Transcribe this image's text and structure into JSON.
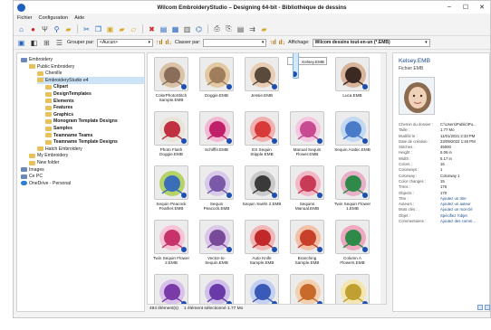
{
  "window": {
    "title": "Wilcom EmbroideryStudio – Designing 64-bit - Bibliothèque de dessins",
    "controls": [
      "–",
      "☐",
      "✕"
    ]
  },
  "menu": [
    "Fichier",
    "Configuration",
    "Aide"
  ],
  "toolbar2": {
    "group_label": "Grouper par:",
    "group_value": "<Aucun>",
    "sort_label": "Classer par:",
    "sort_value": "",
    "display_label": "Affichage:",
    "display_value": "Wilcom dessins tout-en-un (*.EMB)"
  },
  "tree": [
    {
      "label": "Embroidery",
      "icon": "drive",
      "level": 0
    },
    {
      "label": "Public Embroidery",
      "icon": "folder",
      "level": 1
    },
    {
      "label": "Chenille",
      "icon": "folder",
      "level": 2
    },
    {
      "label": "EmbroideryStudio e4",
      "icon": "folder",
      "level": 2,
      "selected": true
    },
    {
      "label": "Clipart",
      "icon": "folder",
      "level": 3
    },
    {
      "label": "DesignTemplates",
      "icon": "folder",
      "level": 3
    },
    {
      "label": "Elements",
      "icon": "folder",
      "level": 3
    },
    {
      "label": "Features",
      "icon": "folder",
      "level": 3
    },
    {
      "label": "Graphics",
      "icon": "folder",
      "level": 3
    },
    {
      "label": "Monogram Template Designs",
      "icon": "folder",
      "level": 3
    },
    {
      "label": "Samples",
      "icon": "folder",
      "level": 3
    },
    {
      "label": "Teamname Teams",
      "icon": "folder",
      "level": 3
    },
    {
      "label": "Teamname Template Designs",
      "icon": "folder",
      "level": 3
    },
    {
      "label": "Hatch Embroidery",
      "icon": "folder",
      "level": 2
    },
    {
      "label": "My Embroidery",
      "icon": "folder",
      "level": 1
    },
    {
      "label": "New folder",
      "icon": "folder",
      "level": 1
    },
    {
      "label": "Images",
      "icon": "drive",
      "level": 0
    },
    {
      "label": "Ce PC",
      "icon": "drive",
      "level": 0
    },
    {
      "label": "OneDrive - Personal",
      "icon": "cloud",
      "level": 0
    }
  ],
  "thumbnails": [
    {
      "caption": "ColorPhotoStitch Sample.EMB",
      "color": "#8a6e5a",
      "accent": "#d9c2a8"
    },
    {
      "caption": "Doggie.EMB",
      "color": "#a07d5c",
      "accent": "#e2c9a3"
    },
    {
      "caption": "Jessie.EMB",
      "color": "#5a4a3c",
      "accent": "#e8cdb4"
    },
    {
      "caption": "Kelsey.EMB",
      "color": "#9a7a5c",
      "accent": "#f0d6bf",
      "selected": true
    },
    {
      "caption": "Luca.EMB",
      "color": "#3a2a22",
      "accent": "#d8b49a"
    },
    {
      "caption": "Photo Flash Doggie.EMB",
      "color": "#c03040",
      "accent": "#e9e3d8"
    },
    {
      "caption": "SchiffliI.EMB",
      "color": "#c0206a",
      "accent": "#f3b8d2"
    },
    {
      "caption": "ES Sequin Stipple.EMB",
      "color": "#d83a3a",
      "accent": "#f2b0b0"
    },
    {
      "caption": "Manual Sequin Flower.EMB",
      "color": "#c84a90",
      "accent": "#f5c8e0"
    },
    {
      "caption": "Sequin Arabic.EMB",
      "color": "#4a7bc8",
      "accent": "#c3d8f2"
    },
    {
      "caption": "Sequin Peacock Feather.EMB",
      "color": "#3a6fb8",
      "accent": "#b6d36a"
    },
    {
      "caption": "Sequin Peacock.EMB",
      "color": "#7a5aa8",
      "accent": "#d6c9ea"
    },
    {
      "caption": "Sequin Swirls 2.EMB",
      "color": "#3a3a3a",
      "accent": "#c9c9c9"
    },
    {
      "caption": "Sequins Manual.EMB",
      "color": "#c83a58",
      "accent": "#f3b8c6"
    },
    {
      "caption": "Twin Sequin Flower 1.EMB",
      "color": "#2f8a4a",
      "accent": "#e8b0c8"
    },
    {
      "caption": "Twin Sequin Flower 2.EMB",
      "color": "#c8326a",
      "accent": "#f6c4d6"
    },
    {
      "caption": "Vector-to-Sequin.EMB",
      "color": "#7a4a9a",
      "accent": "#d9c8e8"
    },
    {
      "caption": "Auto Knife Sample.EMB",
      "color": "#c0282a",
      "accent": "#f1b7b7"
    },
    {
      "caption": "Branching Sample.EMB",
      "color": "#c8402a",
      "accent": "#f3c0a8"
    },
    {
      "caption": "Column A Flowers.EMB",
      "color": "#2f8a4a",
      "accent": "#f0a8c0"
    },
    {
      "caption": "",
      "color": "#7a3aa8",
      "accent": "#d9c2ea"
    },
    {
      "caption": "",
      "color": "#6a3aa8",
      "accent": "#cfc0ea"
    },
    {
      "caption": "",
      "color": "#3a5ab8",
      "accent": "#c3d0f2"
    },
    {
      "caption": "",
      "color": "#c86a2a",
      "accent": "#f3d0b0"
    },
    {
      "caption": "",
      "color": "#c0a030",
      "accent": "#f3e6b0"
    }
  ],
  "properties": {
    "title": "Kelsey.EMB",
    "subtitle": "Fichier EMB",
    "rows": [
      {
        "k": "Chemin du dossier :",
        "v": "C:\\Users\\Public\\Pu..."
      },
      {
        "k": "Taille :",
        "v": "1.77 Mo"
      },
      {
        "k": "Modifié le :",
        "v": "11/01/2021 2:33 PM"
      },
      {
        "k": "Date de création :",
        "v": "23/09/2022 1:46 PM"
      },
      {
        "k": "Stitches :",
        "v": "45000"
      },
      {
        "k": "Height :",
        "v": "5.06 in"
      },
      {
        "k": "Width :",
        "v": "5.17 in"
      },
      {
        "k": "Colors :",
        "v": "16"
      },
      {
        "k": "Colorways :",
        "v": "1"
      },
      {
        "k": "Colorway :",
        "v": "Colorway 1"
      },
      {
        "k": "Color changes :",
        "v": "15"
      },
      {
        "k": "Trims :",
        "v": "176"
      },
      {
        "k": "Objects :",
        "v": "170"
      },
      {
        "k": "Titre :",
        "v": "Ajoutez un titre"
      },
      {
        "k": "Auteurs :",
        "v": "Ajoutez un auteur"
      },
      {
        "k": "Mots clés :",
        "v": "Ajoutez un mot-clé"
      },
      {
        "k": "Objet :",
        "v": "Spécifiez l'objet"
      },
      {
        "k": "Commentaires :",
        "v": "Ajoutez des comm..."
      }
    ]
  },
  "status": {
    "count": "494 élément(s)",
    "selected": "1 élément sélectionné  1.77 Mo"
  },
  "colors": {
    "accent": "#1f5fbf",
    "selection": "#cde3f7"
  }
}
